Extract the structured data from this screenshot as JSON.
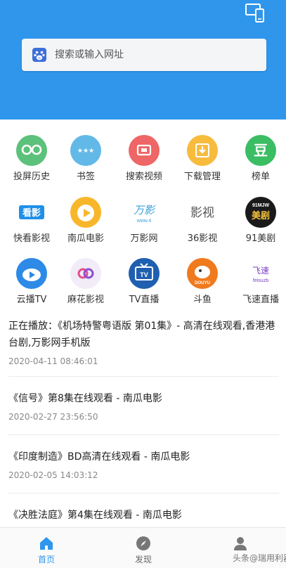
{
  "search": {
    "placeholder": "搜索或输入网址"
  },
  "shortcuts": [
    {
      "label": "投屏历史",
      "icon": "glasses-icon",
      "color": "#5cc17a"
    },
    {
      "label": "书签",
      "icon": "stars-icon",
      "color": "#62b9e8"
    },
    {
      "label": "搜索视频",
      "icon": "video-search-icon",
      "color": "#ee6666"
    },
    {
      "label": "下载管理",
      "icon": "download-icon",
      "color": "#f7bb3d"
    },
    {
      "label": "榜单",
      "icon": "douban-icon",
      "color": "#3bbd63"
    },
    {
      "label": "快看影视",
      "icon": "kuaikan-logo",
      "color": "#1e90e8"
    },
    {
      "label": "南瓜电影",
      "icon": "pumpkin-logo",
      "color": "#f8b62a"
    },
    {
      "label": "万影网",
      "icon": "wanying-logo",
      "color": "#3aa0d8"
    },
    {
      "label": "36影视",
      "icon": "yingshi36-logo",
      "color": "#555555"
    },
    {
      "label": "91美剧",
      "icon": "meiju91-logo",
      "color": "#1a1a1a"
    },
    {
      "label": "云播TV",
      "icon": "cloud-play-icon",
      "color": "#2d8ae6"
    },
    {
      "label": "麻花影视",
      "icon": "mahua-logo",
      "color": "#8b4fd1"
    },
    {
      "label": "TV直播",
      "icon": "tv-icon",
      "color": "#1f5fb0"
    },
    {
      "label": "斗鱼",
      "icon": "douyu-logo",
      "color": "#f07a1e"
    },
    {
      "label": "飞速直播",
      "icon": "feisu-logo",
      "color": "#7b3fc9"
    }
  ],
  "logo_text": {
    "kuaikan": "看影",
    "wanying": "万影",
    "wanying_url": "www.4",
    "yingshi36": "影视",
    "meiju91_top": "91MJW",
    "meiju91_main": "美剧",
    "douyu": "DOUYU",
    "feisu": "飞速",
    "feisu_sub": "feisuzb",
    "douban": "豆",
    "tv": "TV"
  },
  "history": [
    {
      "title": "正在播放：《机场特警粤语版 第01集》- 高清在线观看,香港港台剧,万影网手机版",
      "time": "2020-04-11 08:46:01"
    },
    {
      "title": "《信号》第8集在线观看 - 南瓜电影",
      "time": "2020-02-27 23:56:50"
    },
    {
      "title": "《印度制造》BD高清在线观看 - 南瓜电影",
      "time": "2020-02-05 14:03:12"
    },
    {
      "title": "《决胜法庭》第4集在线观看 - 南瓜电影",
      "time": ""
    }
  ],
  "nav": [
    {
      "label": "首页",
      "icon": "home-icon",
      "active": true
    },
    {
      "label": "发现",
      "icon": "compass-icon",
      "active": false
    },
    {
      "label": "",
      "icon": "person-icon",
      "active": false
    }
  ],
  "watermark": "头条@瑞用利器",
  "colors": {
    "primary": "#2f96ec",
    "text": "#222222",
    "muted": "#888888"
  }
}
